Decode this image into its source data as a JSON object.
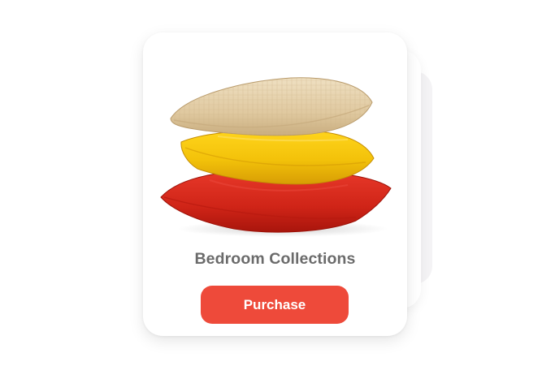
{
  "product": {
    "title": "Bedroom Collections",
    "image_icon": "pillow-stack-image"
  },
  "actions": {
    "purchase_label": "Purchase"
  },
  "colors": {
    "accent": "#ee4a3a",
    "title_text": "#6b6b6b",
    "pillow_top": "#e3cfa8",
    "pillow_middle": "#f2c40c",
    "pillow_bottom": "#d42a1c"
  }
}
